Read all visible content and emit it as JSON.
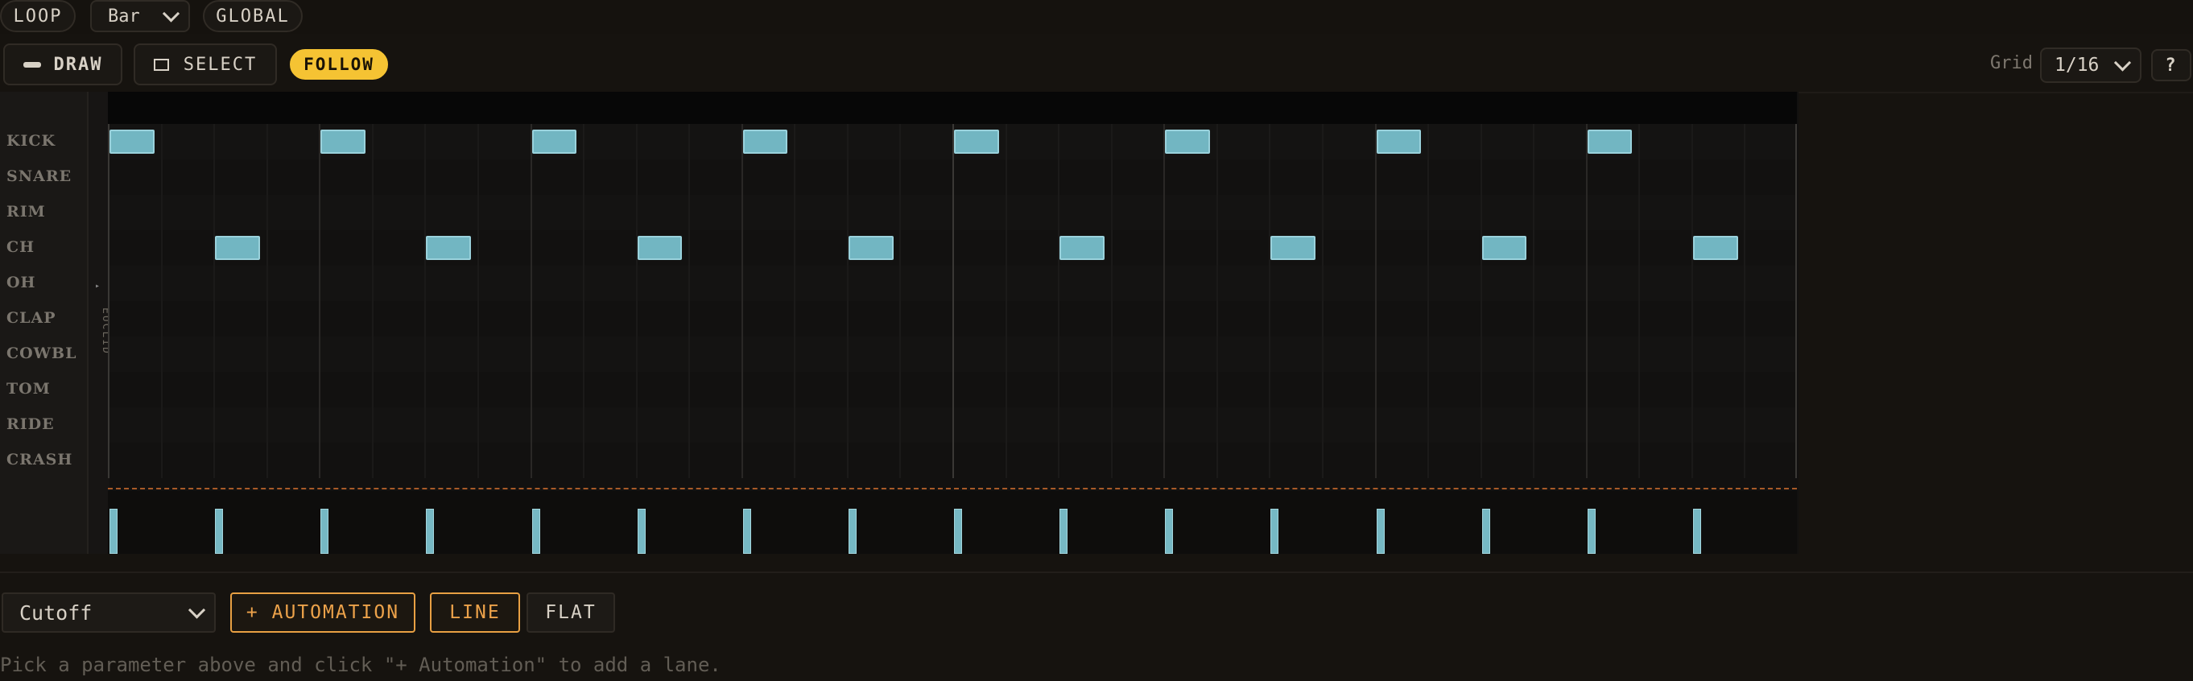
{
  "top": {
    "loop_label": "LOOP",
    "bar_select_value": "Bar",
    "global_label": "GLOBAL"
  },
  "toolbar": {
    "draw_label": "DRAW",
    "select_label": "SELECT",
    "follow_label": "FOLLOW",
    "grid_label": "Grid",
    "grid_value": "1/16",
    "help_label": "?"
  },
  "sequencer": {
    "euclid_label": "EUCLID",
    "steps": 32,
    "tracks": [
      {
        "name": "KICK",
        "steps": [
          0,
          4,
          8,
          12,
          16,
          20,
          24,
          28
        ]
      },
      {
        "name": "SNARE",
        "steps": []
      },
      {
        "name": "RIM",
        "steps": []
      },
      {
        "name": "CH",
        "steps": [
          2,
          6,
          10,
          14,
          18,
          22,
          26,
          30
        ]
      },
      {
        "name": "OH",
        "steps": []
      },
      {
        "name": "CLAP",
        "steps": []
      },
      {
        "name": "COWBL",
        "steps": []
      },
      {
        "name": "TOM",
        "steps": []
      },
      {
        "name": "RIDE",
        "steps": []
      },
      {
        "name": "CRASH",
        "steps": []
      }
    ],
    "velocity_steps": [
      0,
      2,
      4,
      6,
      8,
      10,
      12,
      14,
      16,
      18,
      20,
      22,
      24,
      26,
      28,
      30
    ]
  },
  "automation": {
    "param_value": "Cutoff",
    "add_label": "+ AUTOMATION",
    "line_label": "LINE",
    "flat_label": "FLAT",
    "hint": "Pick a parameter above and click \"+ Automation\" to add a lane."
  },
  "colors": {
    "accent_yellow": "#f5c333",
    "accent_orange": "#e8a043",
    "note_fill": "#72b6c2",
    "background": "#16130f"
  }
}
